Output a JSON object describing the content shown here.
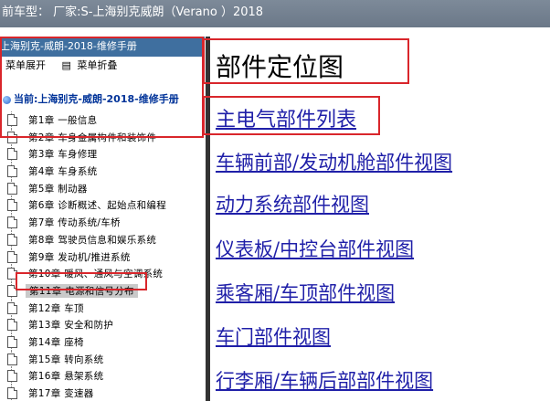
{
  "topbar": {
    "text": "前车型：  厂家:S-上海别克威朗（Verano ）2018"
  },
  "left": {
    "header": "上海别克-威朗-2018-维修手册",
    "expand": "菜单展开",
    "collapse": "菜单折叠",
    "current": "当前:上海别克-威朗-2018-维修手册",
    "chapters": [
      "第1章 一般信息",
      "第2章 车身金属构件和装饰件",
      "第3章 车身修理",
      "第4章 车身系统",
      "第5章 制动器",
      "第6章 诊断概述、起始点和编程",
      "第7章 传动系统/车桥",
      "第8章 驾驶员信息和娱乐系统",
      "第9章 发动机/推进系统",
      "第10章 暖风、通风与空调系统",
      "第11章 电源和信号分布",
      "第12章 车顶",
      "第13章 安全和防护",
      "第14章 座椅",
      "第15章 转向系统",
      "第16章 悬架系统",
      "第17章 变速器"
    ],
    "selected_index": 10
  },
  "right": {
    "title": "部件定位图",
    "links": [
      "主电气部件列表",
      "车辆前部/发动机舱部件视图",
      "动力系统部件视图",
      "仪表板/中控台部件视图",
      "乘客厢/车顶部件视图",
      "车门部件视图",
      "行李厢/车辆后部部件视图"
    ]
  },
  "colors": {
    "highlight_box": "#d9262b",
    "link": "#1f1fa8",
    "header": "#3f6f9f"
  }
}
